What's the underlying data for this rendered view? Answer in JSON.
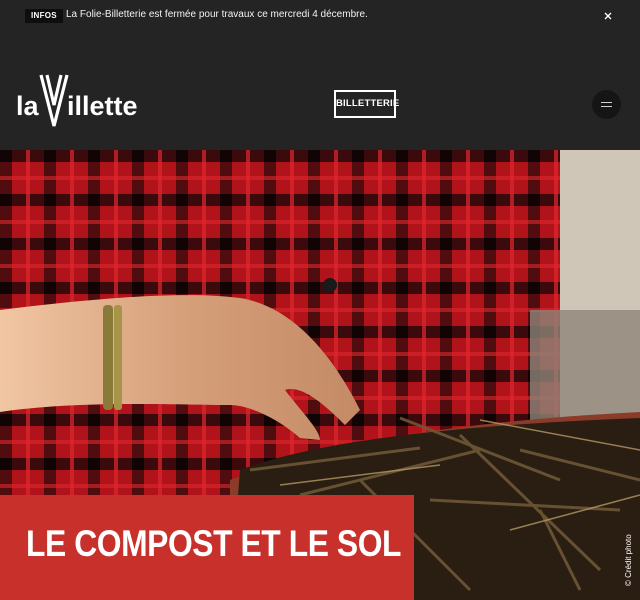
{
  "infobar": {
    "badge": "INFOS",
    "message": "La Folie-Billetterie est fermée pour travaux ce mercredi 4 décembre.",
    "close_icon": "close-icon"
  },
  "header": {
    "logo_text": "laVillette",
    "billetterie_label": "BILLETTERIE",
    "menu_icon": "hamburger-icon"
  },
  "hero": {
    "title": "LE COMPOST ET LE SOL",
    "photo_credit": "© Crédit photo",
    "image_subject": "compost-hands-photo"
  },
  "colors": {
    "background": "#242424",
    "accent_red": "#c8302b",
    "text": "#ffffff"
  }
}
